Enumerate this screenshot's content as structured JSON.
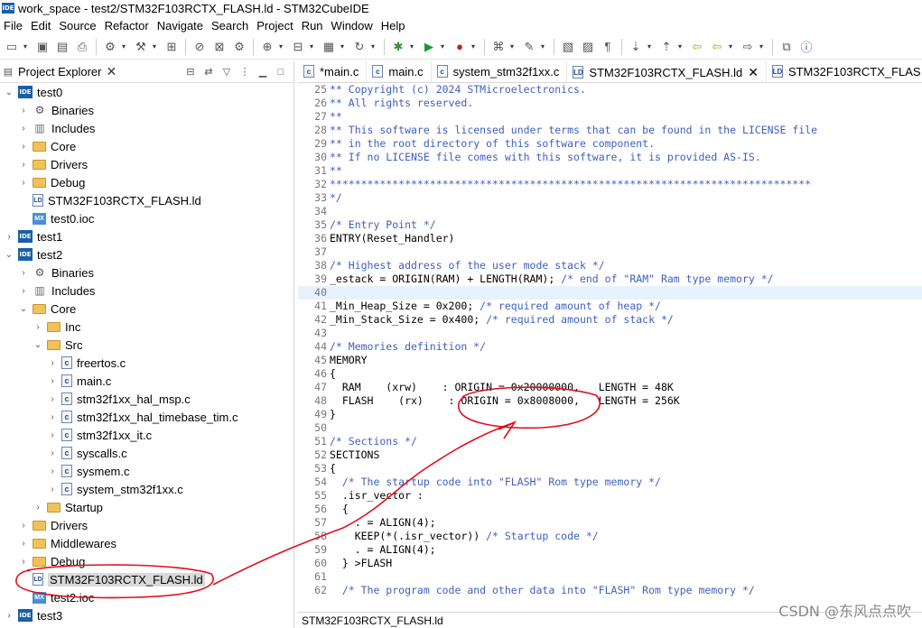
{
  "window": {
    "title": "work_space - test2/STM32F103RCTX_FLASH.ld - STM32CubeIDE",
    "badge": "IDE"
  },
  "menu": [
    "File",
    "Edit",
    "Source",
    "Refactor",
    "Navigate",
    "Search",
    "Project",
    "Run",
    "Window",
    "Help"
  ],
  "explorer": {
    "tab_label": "Project Explorer",
    "tree": [
      {
        "indent": 0,
        "chev": "v",
        "icon": "ide",
        "label": "test0"
      },
      {
        "indent": 1,
        "chev": ">",
        "icon": "bin",
        "label": "Binaries"
      },
      {
        "indent": 1,
        "chev": ">",
        "icon": "inc",
        "label": "Includes"
      },
      {
        "indent": 1,
        "chev": ">",
        "icon": "folder",
        "label": "Core"
      },
      {
        "indent": 1,
        "chev": ">",
        "icon": "folder",
        "label": "Drivers"
      },
      {
        "indent": 1,
        "chev": ">",
        "icon": "folder",
        "label": "Debug"
      },
      {
        "indent": 1,
        "chev": "",
        "icon": "ld",
        "label": "STM32F103RCTX_FLASH.ld"
      },
      {
        "indent": 1,
        "chev": "",
        "icon": "mx",
        "label": "test0.ioc"
      },
      {
        "indent": 0,
        "chev": ">",
        "icon": "ide",
        "label": "test1"
      },
      {
        "indent": 0,
        "chev": "v",
        "icon": "ide",
        "label": "test2"
      },
      {
        "indent": 1,
        "chev": ">",
        "icon": "bin",
        "label": "Binaries"
      },
      {
        "indent": 1,
        "chev": ">",
        "icon": "inc",
        "label": "Includes"
      },
      {
        "indent": 1,
        "chev": "v",
        "icon": "folder",
        "label": "Core"
      },
      {
        "indent": 2,
        "chev": ">",
        "icon": "folder",
        "label": "Inc"
      },
      {
        "indent": 2,
        "chev": "v",
        "icon": "folder",
        "label": "Src"
      },
      {
        "indent": 3,
        "chev": ">",
        "icon": "c",
        "label": "freertos.c"
      },
      {
        "indent": 3,
        "chev": ">",
        "icon": "c",
        "label": "main.c"
      },
      {
        "indent": 3,
        "chev": ">",
        "icon": "c",
        "label": "stm32f1xx_hal_msp.c"
      },
      {
        "indent": 3,
        "chev": ">",
        "icon": "c",
        "label": "stm32f1xx_hal_timebase_tim.c"
      },
      {
        "indent": 3,
        "chev": ">",
        "icon": "c",
        "label": "stm32f1xx_it.c"
      },
      {
        "indent": 3,
        "chev": ">",
        "icon": "c",
        "label": "syscalls.c"
      },
      {
        "indent": 3,
        "chev": ">",
        "icon": "c",
        "label": "sysmem.c"
      },
      {
        "indent": 3,
        "chev": ">",
        "icon": "c",
        "label": "system_stm32f1xx.c"
      },
      {
        "indent": 2,
        "chev": ">",
        "icon": "folder",
        "label": "Startup"
      },
      {
        "indent": 1,
        "chev": ">",
        "icon": "folder",
        "label": "Drivers"
      },
      {
        "indent": 1,
        "chev": ">",
        "icon": "folder",
        "label": "Middlewares"
      },
      {
        "indent": 1,
        "chev": ">",
        "icon": "folder",
        "label": "Debug"
      },
      {
        "indent": 1,
        "chev": "",
        "icon": "ld",
        "label": "STM32F103RCTX_FLASH.ld",
        "selected": true
      },
      {
        "indent": 1,
        "chev": "",
        "icon": "mx",
        "label": "test2.ioc"
      },
      {
        "indent": 0,
        "chev": ">",
        "icon": "ide",
        "label": "test3"
      }
    ]
  },
  "editor": {
    "tabs": [
      {
        "label": "*main.c",
        "icon": "c",
        "active": false,
        "close": false
      },
      {
        "label": "main.c",
        "icon": "c",
        "active": false,
        "close": false
      },
      {
        "label": "system_stm32f1xx.c",
        "icon": "c",
        "active": false,
        "close": false
      },
      {
        "label": "STM32F103RCTX_FLASH.ld",
        "icon": "ld",
        "active": true,
        "close": true
      },
      {
        "label": "STM32F103RCTX_FLAS",
        "icon": "ld",
        "active": false,
        "close": false
      }
    ],
    "bottom_tab": "STM32F103RCTX_FLASH.ld",
    "lines": [
      {
        "n": "25",
        "t": "** Copyright (c) 2024 STMicroelectronics.",
        "c": "cm"
      },
      {
        "n": "26",
        "t": "** All rights reserved.",
        "c": "cm"
      },
      {
        "n": "27",
        "t": "**",
        "c": "cm"
      },
      {
        "n": "28",
        "t": "** This software is licensed under terms that can be found in the LICENSE file",
        "c": "cm"
      },
      {
        "n": "29",
        "t": "** in the root directory of this software component.",
        "c": "cm"
      },
      {
        "n": "30",
        "t": "** If no LICENSE file comes with this software, it is provided AS-IS.",
        "c": "cm"
      },
      {
        "n": "31",
        "t": "**",
        "c": "cm"
      },
      {
        "n": "32",
        "t": "*****************************************************************************",
        "c": "cm"
      },
      {
        "n": "33",
        "t": "*/",
        "c": "cm"
      },
      {
        "n": "34",
        "t": "",
        "c": ""
      },
      {
        "n": "35",
        "t": "/* Entry Point */",
        "c": "cm"
      },
      {
        "n": "36",
        "t": "ENTRY(Reset_Handler)",
        "c": ""
      },
      {
        "n": "37",
        "t": "",
        "c": ""
      },
      {
        "n": "38",
        "t": "/* Highest address of the user mode stack */",
        "c": "cm"
      },
      {
        "n": "39",
        "t": "_estack = ORIGIN(RAM) + LENGTH(RAM); /* end of \"RAM\" Ram type memory */",
        "c": "mix"
      },
      {
        "n": "40",
        "t": "",
        "c": "",
        "hl": true
      },
      {
        "n": "41",
        "t": "_Min_Heap_Size = 0x200; /* required amount of heap */",
        "c": "mix"
      },
      {
        "n": "42",
        "t": "_Min_Stack_Size = 0x400; /* required amount of stack */",
        "c": "mix"
      },
      {
        "n": "43",
        "t": "",
        "c": ""
      },
      {
        "n": "44",
        "t": "/* Memories definition */",
        "c": "cm"
      },
      {
        "n": "45",
        "t": "MEMORY",
        "c": ""
      },
      {
        "n": "46",
        "t": "{",
        "c": ""
      },
      {
        "n": "47",
        "t": "  RAM    (xrw)    : ORIGIN = 0x20000000,   LENGTH = 48K",
        "c": ""
      },
      {
        "n": "48",
        "t": "  FLASH    (rx)    : ORIGIN = 0x8008000,   LENGTH = 256K",
        "c": ""
      },
      {
        "n": "49",
        "t": "}",
        "c": ""
      },
      {
        "n": "50",
        "t": "",
        "c": ""
      },
      {
        "n": "51",
        "t": "/* Sections */",
        "c": "cm"
      },
      {
        "n": "52",
        "t": "SECTIONS",
        "c": ""
      },
      {
        "n": "53",
        "t": "{",
        "c": ""
      },
      {
        "n": "54",
        "t": "  /* The startup code into \"FLASH\" Rom type memory */",
        "c": "cm"
      },
      {
        "n": "55",
        "t": "  .isr_vector :",
        "c": ""
      },
      {
        "n": "56",
        "t": "  {",
        "c": ""
      },
      {
        "n": "57",
        "t": "    . = ALIGN(4);",
        "c": ""
      },
      {
        "n": "58",
        "t": "    KEEP(*(.isr_vector)) /* Startup code */",
        "c": "mix"
      },
      {
        "n": "59",
        "t": "    . = ALIGN(4);",
        "c": ""
      },
      {
        "n": "60",
        "t": "  } >FLASH",
        "c": ""
      },
      {
        "n": "61",
        "t": "",
        "c": ""
      },
      {
        "n": "62",
        "t": "  /* The program code and other data into \"FLASH\" Rom type memory */",
        "c": "cm"
      }
    ]
  },
  "watermark": "CSDN @东风点点吹",
  "colors": {
    "annotation": "#e0101a",
    "comment": "#3f5fbf",
    "ide_badge": "#1b5fa8"
  }
}
